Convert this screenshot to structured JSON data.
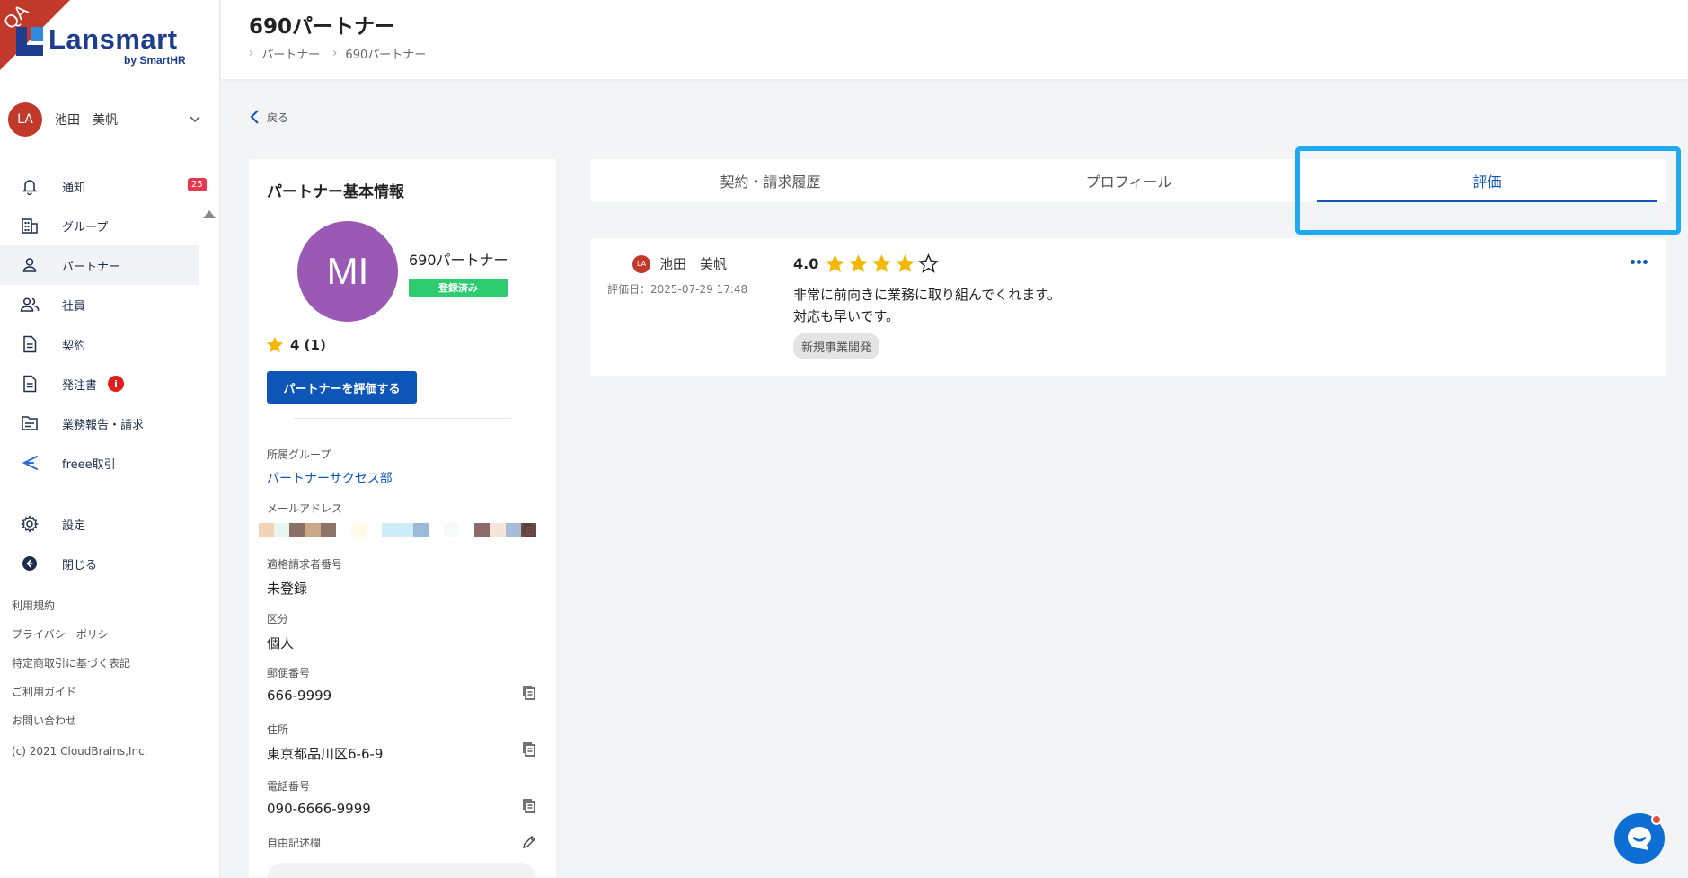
{
  "env_ribbon": "QA",
  "brand": {
    "name": "Lansmart",
    "sub": "by SmartHR"
  },
  "user": {
    "initials": "LA",
    "name": "池田　美帆"
  },
  "nav": [
    {
      "key": "notice",
      "label": "通知",
      "icon": "bell-icon",
      "badge": "25"
    },
    {
      "key": "group",
      "label": "グループ",
      "icon": "building-icon"
    },
    {
      "key": "partner",
      "label": "パートナー",
      "icon": "person-icon",
      "active": true
    },
    {
      "key": "employee",
      "label": "社員",
      "icon": "people-icon"
    },
    {
      "key": "contract",
      "label": "契約",
      "icon": "document-icon"
    },
    {
      "key": "order",
      "label": "発注書",
      "icon": "document-icon",
      "alert": "i"
    },
    {
      "key": "report",
      "label": "業務報告・請求",
      "icon": "folder-icon"
    },
    {
      "key": "freee",
      "label": "freee取引",
      "icon": "freee-icon"
    }
  ],
  "nav2": [
    {
      "key": "settings",
      "label": "設定",
      "icon": "gear-icon"
    },
    {
      "key": "close",
      "label": "閉じる",
      "icon": "close-circle-icon"
    }
  ],
  "footer": {
    "links": [
      "利用規約",
      "プライバシーポリシー",
      "特定商取引に基づく表記",
      "ご利用ガイド",
      "お問い合わせ"
    ],
    "copyright": "(c) 2021 CloudBrains,Inc."
  },
  "header": {
    "title": "690パートナー",
    "breadcrumb": [
      "パートナー",
      "690パートナー"
    ]
  },
  "back_label": "戻る",
  "partner": {
    "section_title": "パートナー基本情報",
    "initials": "MI",
    "name": "690パートナー",
    "status": "登録済み",
    "rating": "4 (1)",
    "eval_button": "パートナーを評価する",
    "fields": {
      "group_label": "所属グループ",
      "group_value": "パートナーサクセス部",
      "email_label": "メールアドレス",
      "invoice_label": "適格請求者番号",
      "invoice_value": "未登録",
      "type_label": "区分",
      "type_value": "個人",
      "zip_label": "郵便番号",
      "zip_value": "666-9999",
      "address_label": "住所",
      "address_value": "東京都品川区6-6-9",
      "phone_label": "電話番号",
      "phone_value": "090-6666-9999",
      "memo_label": "自由記述欄"
    }
  },
  "tabs": [
    {
      "label": "契約・請求履歴"
    },
    {
      "label": "プロフィール"
    },
    {
      "label": "評価",
      "active": true
    }
  ],
  "review": {
    "reviewer_initials": "LA",
    "reviewer_name": "池田　美帆",
    "date": "評価日：2025-07-29 17:48",
    "score": "4.0",
    "stars_filled": 4,
    "stars_total": 5,
    "text_line1": "非常に前向きに業務に取り組んでくれます。",
    "text_line2": "対応も早いです。",
    "tag": "新規事業開発"
  },
  "colors": {
    "primary": "#0d56b8",
    "success": "#2dcc70",
    "star": "#f5b800",
    "badge": "#e53950",
    "highlight": "#1fa9f0"
  }
}
